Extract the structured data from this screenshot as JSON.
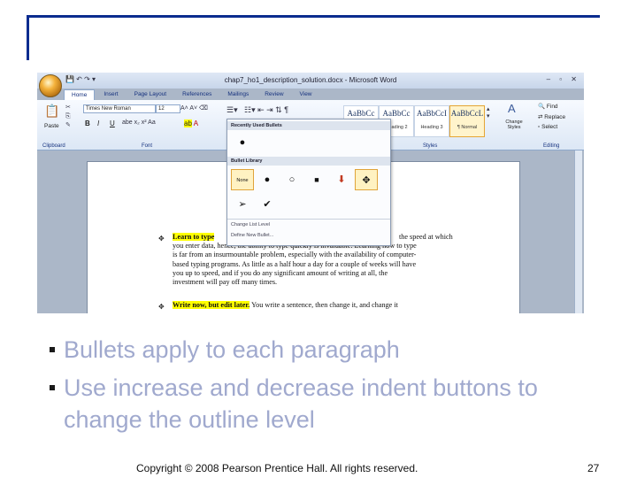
{
  "word": {
    "window_title": "chap7_ho1_description_solution.docx - Microsoft Word",
    "tabs": [
      "Home",
      "Insert",
      "Page Layout",
      "References",
      "Mailings",
      "Review",
      "View"
    ],
    "font_name": "Times New Roman",
    "font_size": "12",
    "groups": {
      "clipboard": "Clipboard",
      "font": "Font",
      "styles": "Styles",
      "editing": "Editing"
    },
    "paste_label": "Paste",
    "format_buttons": [
      "B",
      "I",
      "U"
    ],
    "styles": [
      {
        "preview": "AaBbCc",
        "name": ""
      },
      {
        "preview": "AaBbCc",
        "name": "Heading 2"
      },
      {
        "preview": "AaBbCcI",
        "name": "Heading 3"
      },
      {
        "preview": "AaBbCcL",
        "name": "¶ Normal"
      }
    ],
    "change_styles_label": "Change Styles",
    "editing": {
      "find": "Find",
      "replace": "Replace",
      "select": "Select"
    },
    "dropdown": {
      "recent_header": "Recently Used Bullets",
      "library_header": "Bullet Library",
      "none_label": "None",
      "change_level": "Change List Level",
      "define_new": "Define New Bullet..."
    },
    "document": {
      "para1_highlight": "Learn to type",
      "para1_lines": [
        "the speed at which",
        "you enter data, hence, the ability to type quickly is invaluable. Learning how to type",
        "is far from an insurmountable problem, especially with the availability of computer-",
        "based typing programs. As little as a half hour a day for a couple of weeks will have",
        "you up to speed, and if you do any significant amount of writing at all, the",
        "investment will pay off many times."
      ],
      "para2_highlight": "Write now, but edit later.",
      "para2_rest": "You write a sentence, then change it, and change it"
    }
  },
  "slide": {
    "bullets": [
      "Bullets apply to each paragraph",
      "Use increase and decrease indent buttons to",
      "change the outline level"
    ],
    "copyright": "Copyright © 2008 Pearson Prentice Hall. All rights reserved.",
    "page_number": "27"
  }
}
